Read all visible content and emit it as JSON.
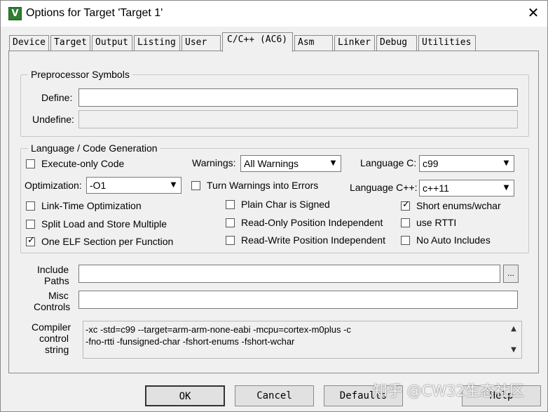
{
  "window": {
    "title": "Options for Target 'Target 1'",
    "close_glyph": "✕",
    "app_icon_letter": "V"
  },
  "tabs": [
    {
      "label": "Device"
    },
    {
      "label": "Target"
    },
    {
      "label": "Output"
    },
    {
      "label": "Listing"
    },
    {
      "label": "User"
    },
    {
      "label": "C/C++ (AC6)",
      "active": true
    },
    {
      "label": "Asm"
    },
    {
      "label": "Linker"
    },
    {
      "label": "Debug"
    },
    {
      "label": "Utilities"
    }
  ],
  "preprocessor": {
    "group_label": "Preprocessor Symbols",
    "define_label": "Define:",
    "define_value": "",
    "undefine_label": "Undefine:",
    "undefine_value": ""
  },
  "codegen": {
    "group_label": "Language / Code Generation",
    "execute_only": {
      "label": "Execute-only Code",
      "checked": false
    },
    "warnings_label": "Warnings:",
    "warnings_value": "All Warnings",
    "language_c_label": "Language C:",
    "language_c_value": "c99",
    "optimization_label": "Optimization:",
    "optimization_value": "-O1",
    "turn_warnings_errors": {
      "label": "Turn Warnings into Errors",
      "checked": false
    },
    "language_cpp_label": "Language C++:",
    "language_cpp_value": "c++11",
    "link_time_opt": {
      "label": "Link-Time Optimization",
      "checked": false
    },
    "plain_char_signed": {
      "label": "Plain Char is Signed",
      "checked": false
    },
    "short_enums": {
      "label": "Short enums/wchar",
      "checked": true
    },
    "split_load_store": {
      "label": "Split Load and Store Multiple",
      "checked": false
    },
    "ro_position_independent": {
      "label": "Read-Only Position Independent",
      "checked": false
    },
    "use_rtti": {
      "label": "use RTTI",
      "checked": false
    },
    "one_elf_section": {
      "label": "One ELF Section per Function",
      "checked": true
    },
    "rw_position_independent": {
      "label": "Read-Write Position Independent",
      "checked": false
    },
    "no_auto_includes": {
      "label": "No Auto Includes",
      "checked": false
    }
  },
  "paths": {
    "include_label_1": "Include",
    "include_label_2": "Paths",
    "include_value": "",
    "browse_label": "...",
    "misc_label_1": "Misc",
    "misc_label_2": "Controls",
    "misc_value": ""
  },
  "compiler": {
    "label_1": "Compiler",
    "label_2": "control",
    "label_3": "string",
    "line_1": "-xc -std=c99 --target=arm-arm-none-eabi -mcpu=cortex-m0plus -c",
    "line_2": "-fno-rtti -funsigned-char -fshort-enums -fshort-wchar",
    "scroll_up": "▲",
    "scroll_down": "▼"
  },
  "buttons": {
    "ok": "OK",
    "cancel": "Cancel",
    "defaults": "Defaults",
    "help": "Help"
  },
  "check_glyph": "✓",
  "combo_arrow_glyph": "▼",
  "watermark": "知乎 @CW32生态社区"
}
